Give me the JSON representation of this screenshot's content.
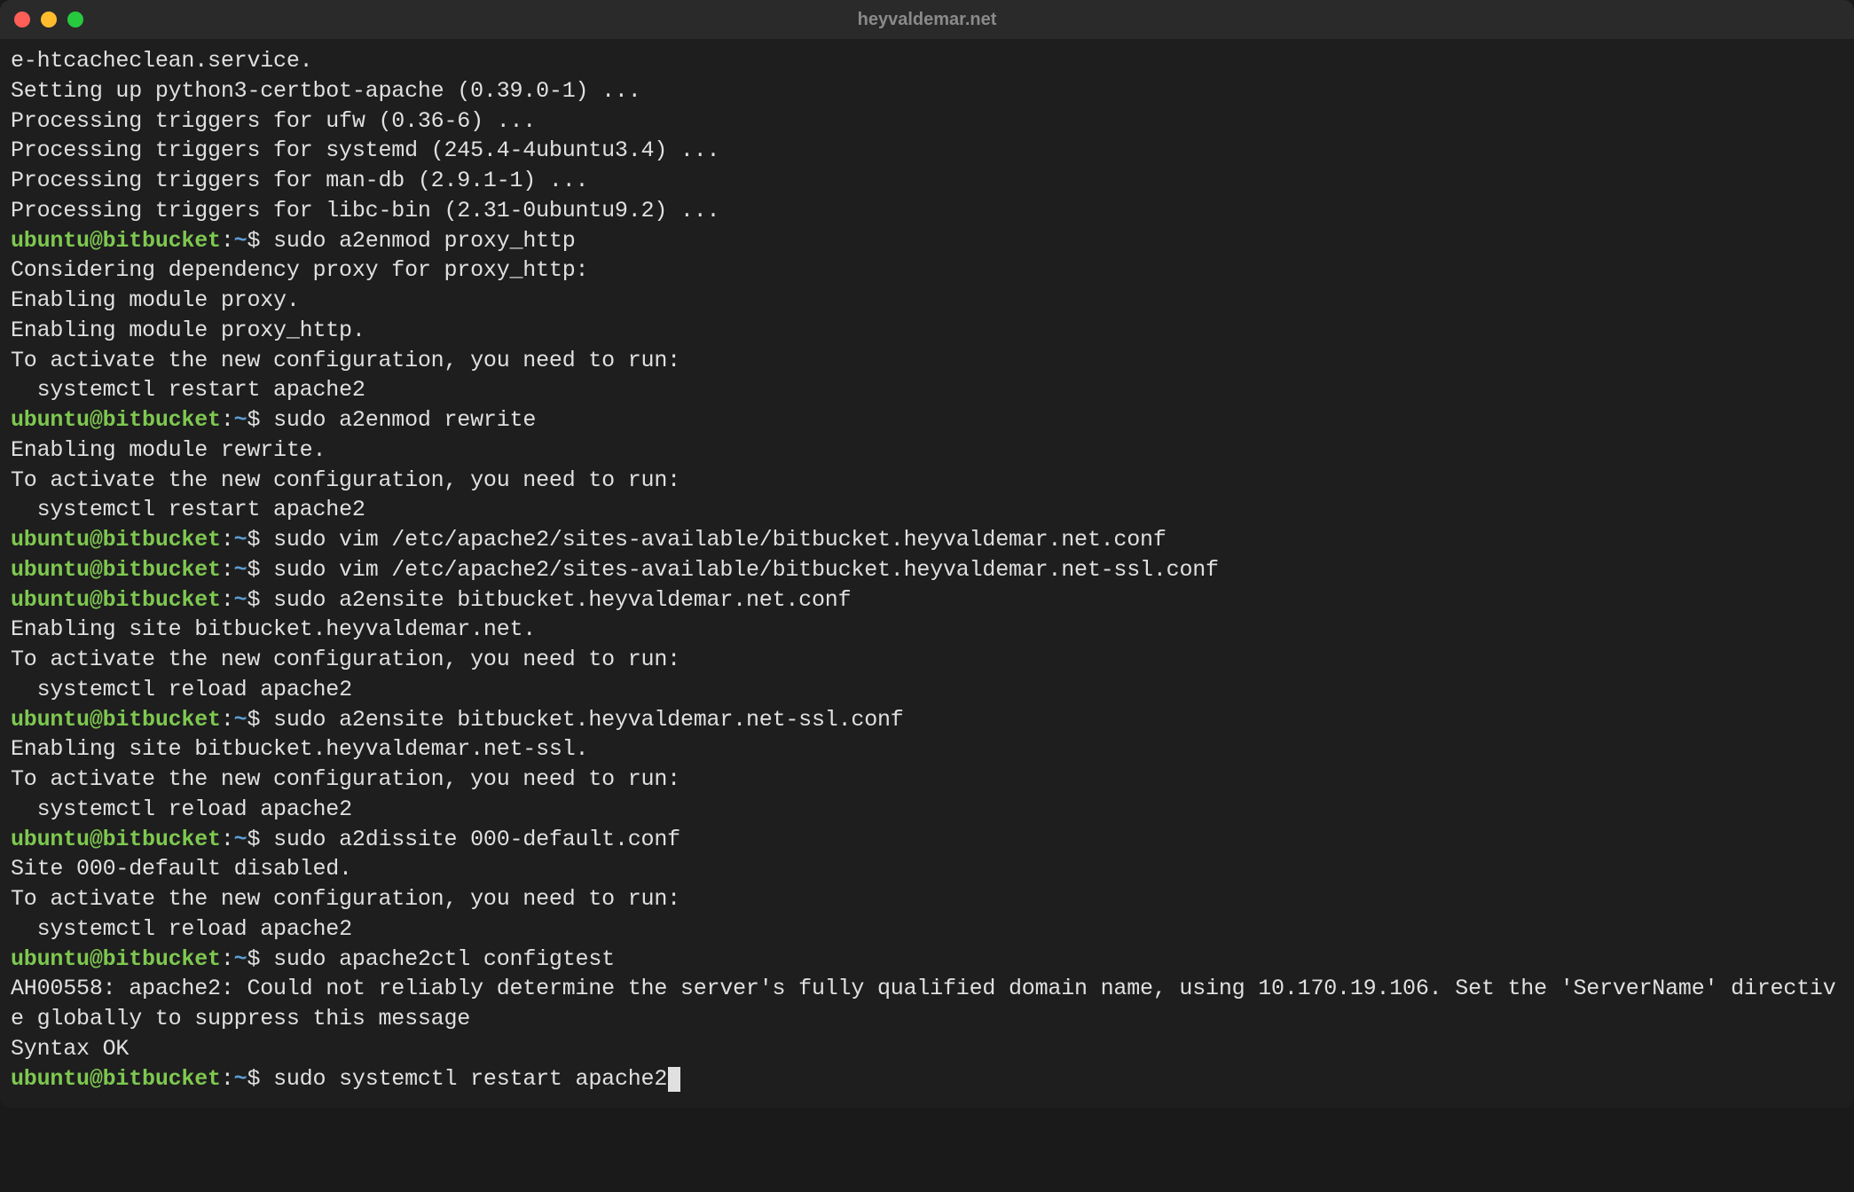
{
  "window": {
    "title": "heyvaldemar.net"
  },
  "prompt": {
    "user_host": "ubuntu@bitbucket",
    "colon": ":",
    "path": "~",
    "dollar": "$ "
  },
  "lines": [
    {
      "type": "output",
      "text": "e-htcacheclean.service."
    },
    {
      "type": "output",
      "text": "Setting up python3-certbot-apache (0.39.0-1) ..."
    },
    {
      "type": "output",
      "text": "Processing triggers for ufw (0.36-6) ..."
    },
    {
      "type": "output",
      "text": "Processing triggers for systemd (245.4-4ubuntu3.4) ..."
    },
    {
      "type": "output",
      "text": "Processing triggers for man-db (2.9.1-1) ..."
    },
    {
      "type": "output",
      "text": "Processing triggers for libc-bin (2.31-0ubuntu9.2) ..."
    },
    {
      "type": "prompt",
      "cmd": "sudo a2enmod proxy_http"
    },
    {
      "type": "output",
      "text": "Considering dependency proxy for proxy_http:"
    },
    {
      "type": "output",
      "text": "Enabling module proxy."
    },
    {
      "type": "output",
      "text": "Enabling module proxy_http."
    },
    {
      "type": "output",
      "text": "To activate the new configuration, you need to run:"
    },
    {
      "type": "output",
      "text": "  systemctl restart apache2"
    },
    {
      "type": "prompt",
      "cmd": "sudo a2enmod rewrite"
    },
    {
      "type": "output",
      "text": "Enabling module rewrite."
    },
    {
      "type": "output",
      "text": "To activate the new configuration, you need to run:"
    },
    {
      "type": "output",
      "text": "  systemctl restart apache2"
    },
    {
      "type": "prompt",
      "cmd": "sudo vim /etc/apache2/sites-available/bitbucket.heyvaldemar.net.conf"
    },
    {
      "type": "prompt",
      "cmd": "sudo vim /etc/apache2/sites-available/bitbucket.heyvaldemar.net-ssl.conf"
    },
    {
      "type": "prompt",
      "cmd": "sudo a2ensite bitbucket.heyvaldemar.net.conf"
    },
    {
      "type": "output",
      "text": "Enabling site bitbucket.heyvaldemar.net."
    },
    {
      "type": "output",
      "text": "To activate the new configuration, you need to run:"
    },
    {
      "type": "output",
      "text": "  systemctl reload apache2"
    },
    {
      "type": "prompt",
      "cmd": "sudo a2ensite bitbucket.heyvaldemar.net-ssl.conf"
    },
    {
      "type": "output",
      "text": "Enabling site bitbucket.heyvaldemar.net-ssl."
    },
    {
      "type": "output",
      "text": "To activate the new configuration, you need to run:"
    },
    {
      "type": "output",
      "text": "  systemctl reload apache2"
    },
    {
      "type": "prompt",
      "cmd": "sudo a2dissite 000-default.conf"
    },
    {
      "type": "output",
      "text": "Site 000-default disabled."
    },
    {
      "type": "output",
      "text": "To activate the new configuration, you need to run:"
    },
    {
      "type": "output",
      "text": "  systemctl reload apache2"
    },
    {
      "type": "prompt",
      "cmd": "sudo apache2ctl configtest"
    },
    {
      "type": "output",
      "text": "AH00558: apache2: Could not reliably determine the server's fully qualified domain name, using 10.170.19.106. Set the 'ServerName' directive globally to suppress this message"
    },
    {
      "type": "output",
      "text": "Syntax OK"
    },
    {
      "type": "prompt",
      "cmd": "sudo systemctl restart apache2",
      "cursor": true
    }
  ]
}
